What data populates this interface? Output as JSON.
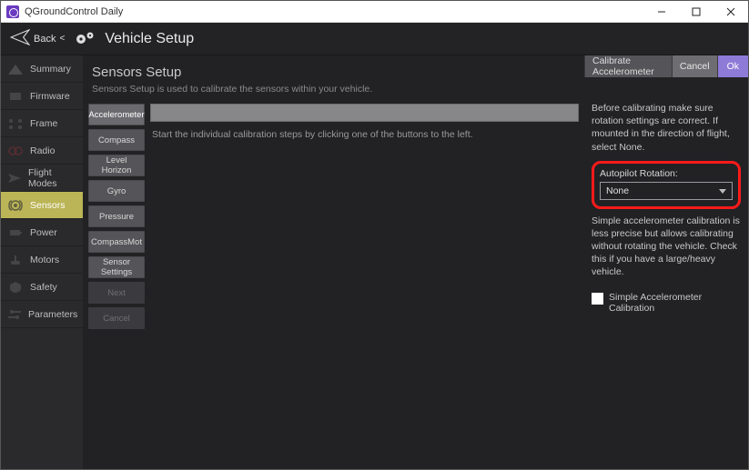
{
  "window": {
    "title": "QGroundControl Daily"
  },
  "header": {
    "back": "Back",
    "chevron": "<",
    "title": "Vehicle Setup"
  },
  "sidebar": {
    "items": [
      {
        "label": "Summary"
      },
      {
        "label": "Firmware"
      },
      {
        "label": "Frame"
      },
      {
        "label": "Radio"
      },
      {
        "label": "Flight Modes"
      },
      {
        "label": "Sensors",
        "active": true
      },
      {
        "label": "Power"
      },
      {
        "label": "Motors"
      },
      {
        "label": "Safety"
      },
      {
        "label": "Parameters"
      }
    ]
  },
  "page": {
    "title": "Sensors Setup",
    "subtitle": "Sensors Setup is used to calibrate the sensors within your vehicle."
  },
  "sensor_buttons": [
    {
      "label": "Accelerometer",
      "state": "selected"
    },
    {
      "label": "Compass"
    },
    {
      "label": "Level Horizon"
    },
    {
      "label": "Gyro"
    },
    {
      "label": "Pressure"
    },
    {
      "label": "CompassMot"
    },
    {
      "label": "Sensor Settings"
    },
    {
      "label": "Next",
      "state": "disabled"
    },
    {
      "label": "Cancel",
      "state": "disabled"
    }
  ],
  "center": {
    "instructions": "Start the individual calibration steps by clicking one of the buttons to the left."
  },
  "right": {
    "actions": {
      "main": "Calibrate Accelerometer",
      "cancel": "Cancel",
      "ok": "Ok"
    },
    "pretext": "Before calibrating make sure rotation settings are correct. If mounted in the direction of flight, select None.",
    "rotation_label": "Autopilot Rotation:",
    "rotation_value": "None",
    "simple_text": "Simple accelerometer calibration is less precise but allows calibrating without rotating the vehicle. Check this if you have a large/heavy vehicle.",
    "checkbox_label": "Simple Accelerometer Calibration"
  }
}
